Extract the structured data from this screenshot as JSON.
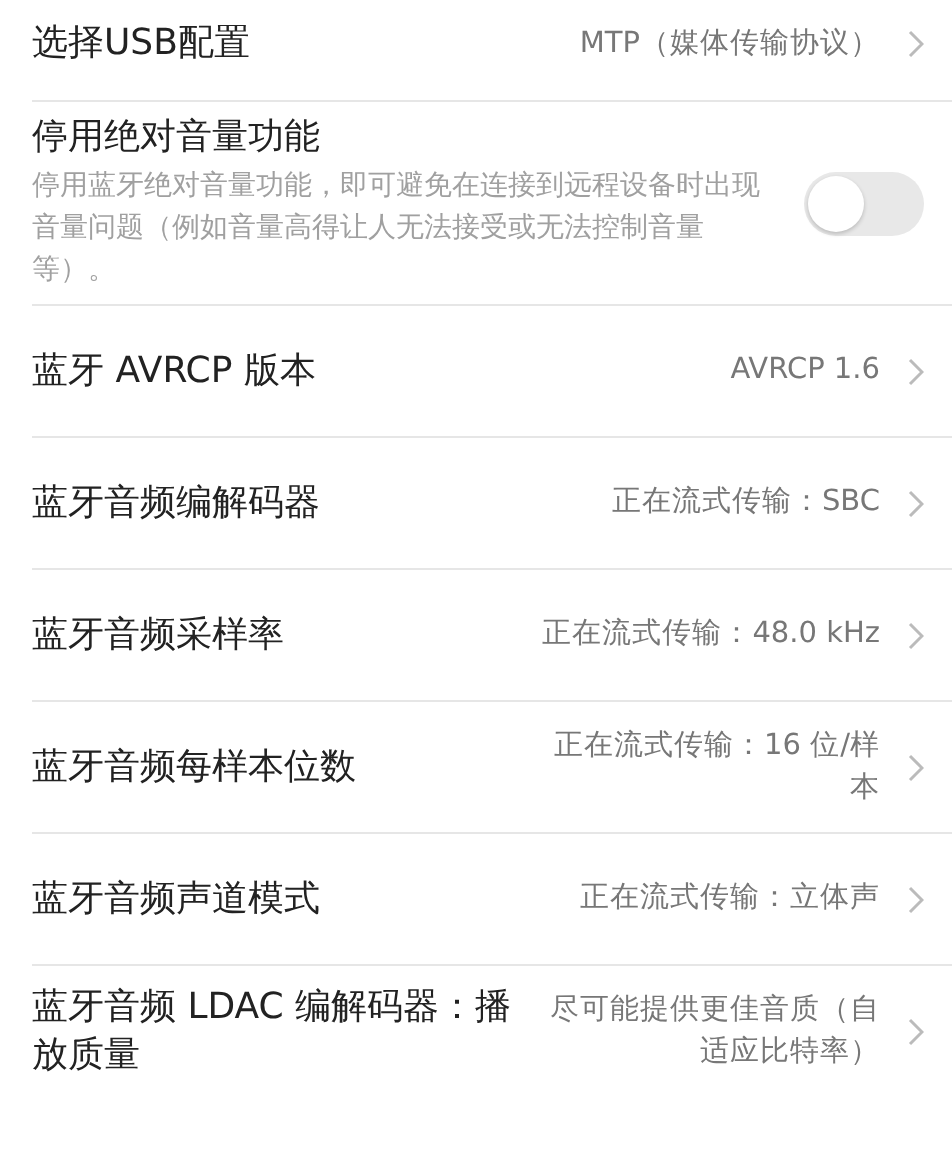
{
  "settings": [
    {
      "kind": "value",
      "title": "选择USB配置",
      "value": "MTP（媒体传输协议）"
    },
    {
      "kind": "toggle",
      "title": "停用绝对音量功能",
      "description": "停用蓝牙绝对音量功能，即可避免在连接到远程设备时出现音量问题（例如音量高得让人无法接受或无法控制音量等）。",
      "on": false
    },
    {
      "kind": "value",
      "title": "蓝牙 AVRCP 版本",
      "value": "AVRCP 1.6"
    },
    {
      "kind": "value",
      "title": "蓝牙音频编解码器",
      "value": "正在流式传输：SBC"
    },
    {
      "kind": "value",
      "title": "蓝牙音频采样率",
      "value": "正在流式传输：48.0 kHz"
    },
    {
      "kind": "value",
      "title": "蓝牙音频每样本位数",
      "value": "正在流式传输：16 位/样本"
    },
    {
      "kind": "value",
      "title": "蓝牙音频声道模式",
      "value": "正在流式传输：立体声"
    },
    {
      "kind": "value",
      "title": "蓝牙音频 LDAC 编解码器：播放质量",
      "value": "尽可能提供更佳音质（自适应比特率）"
    }
  ]
}
